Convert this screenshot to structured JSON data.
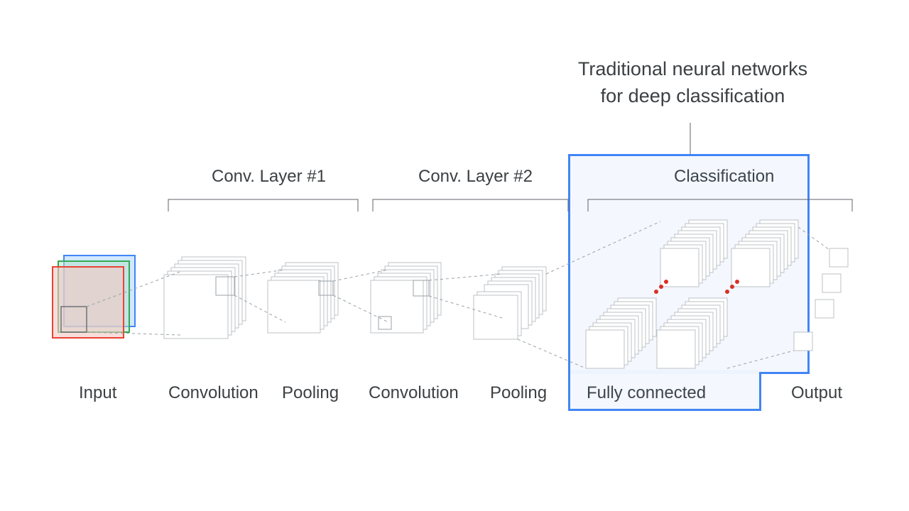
{
  "title_line1": "Traditional neural networks",
  "title_line2": "for deep classification",
  "section_conv1": "Conv. Layer #1",
  "section_conv2": "Conv. Layer #2",
  "section_classification": "Classification",
  "labels": {
    "input": "Input",
    "conv1": "Convolution",
    "pool1": "Pooling",
    "conv2": "Convolution",
    "pool2": "Pooling",
    "fc": "Fully connected",
    "output": "Output"
  },
  "diagram": {
    "type": "cnn-architecture",
    "stages": [
      {
        "name": "Input",
        "channels": 3,
        "colors": [
          "red",
          "green",
          "blue"
        ]
      },
      {
        "name": "Convolution",
        "group": "Conv. Layer #1",
        "stack_count": 6
      },
      {
        "name": "Pooling",
        "group": "Conv. Layer #1",
        "stack_count": 6
      },
      {
        "name": "Convolution",
        "group": "Conv. Layer #2",
        "stack_count": 6
      },
      {
        "name": "Pooling",
        "group": "Conv. Layer #2",
        "stack_count": 6
      },
      {
        "name": "Fully connected",
        "group": "Classification",
        "stack_count": 16,
        "blocks": 4
      },
      {
        "name": "Output",
        "units": 4
      }
    ],
    "highlight": "Fully connected"
  }
}
